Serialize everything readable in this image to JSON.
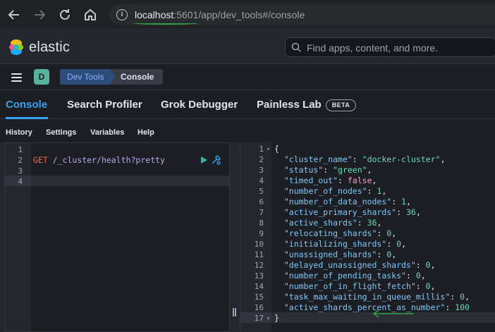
{
  "browser": {
    "url_host": "localhost",
    "url_port": ":5601",
    "url_path": "/app/dev_tools#/console",
    "back_icon": "arrow-left-icon",
    "forward_icon": "arrow-right-icon",
    "reload_icon": "reload-icon",
    "home_icon": "home-icon"
  },
  "header": {
    "logo_text": "elastic",
    "search_placeholder": "Find apps, content, and more."
  },
  "subbar": {
    "space_initial": "D",
    "breadcrumbs": [
      "Dev Tools",
      "Console"
    ]
  },
  "tabs": [
    {
      "label": "Console",
      "active": true
    },
    {
      "label": "Search Profiler",
      "active": false
    },
    {
      "label": "Grok Debugger",
      "active": false
    },
    {
      "label": "Painless Lab",
      "active": false,
      "badge": "BETA"
    }
  ],
  "menu": [
    "History",
    "Settings",
    "Variables",
    "Help"
  ],
  "request": {
    "line_numbers": [
      "1",
      "2",
      "3",
      "4"
    ],
    "method": "GET",
    "path": "/_cluster/health?pretty"
  },
  "response": {
    "line_numbers": [
      "1",
      "2",
      "3",
      "4",
      "5",
      "6",
      "7",
      "8",
      "9",
      "10",
      "11",
      "12",
      "13",
      "14",
      "15",
      "16",
      "17"
    ],
    "open_brace": "{",
    "close_brace": "}",
    "fields": [
      {
        "key": "\"cluster_name\"",
        "value": "\"docker-cluster\"",
        "type": "str",
        "comma": ","
      },
      {
        "key": "\"status\"",
        "value": "\"green\"",
        "type": "str",
        "comma": ","
      },
      {
        "key": "\"timed_out\"",
        "value": "false",
        "type": "kw",
        "comma": ","
      },
      {
        "key": "\"number_of_nodes\"",
        "value": "1",
        "type": "num",
        "comma": ","
      },
      {
        "key": "\"number_of_data_nodes\"",
        "value": "1",
        "type": "num",
        "comma": ","
      },
      {
        "key": "\"active_primary_shards\"",
        "value": "36",
        "type": "num",
        "comma": ","
      },
      {
        "key": "\"active_shards\"",
        "value": "36",
        "type": "num",
        "comma": ","
      },
      {
        "key": "\"relocating_shards\"",
        "value": "0",
        "type": "num",
        "comma": ","
      },
      {
        "key": "\"initializing_shards\"",
        "value": "0",
        "type": "num",
        "comma": ","
      },
      {
        "key": "\"unassigned_shards\"",
        "value": "0",
        "type": "num",
        "comma": ","
      },
      {
        "key": "\"delayed_unassigned_shards\"",
        "value": "0",
        "type": "num",
        "comma": ","
      },
      {
        "key": "\"number_of_pending_tasks\"",
        "value": "0",
        "type": "num",
        "comma": ","
      },
      {
        "key": "\"number_of_in_flight_fetch\"",
        "value": "0",
        "type": "num",
        "comma": ","
      },
      {
        "key": "\"task_max_waiting_in_queue_millis\"",
        "value": "0",
        "type": "num",
        "comma": ","
      },
      {
        "key": "\"active_shards_percent_as_number\"",
        "value": "100",
        "type": "num",
        "comma": ""
      }
    ]
  },
  "colors": {
    "accent": "#36a2ef",
    "annotation": "#2ea043",
    "space_avatar": "#54b399"
  }
}
